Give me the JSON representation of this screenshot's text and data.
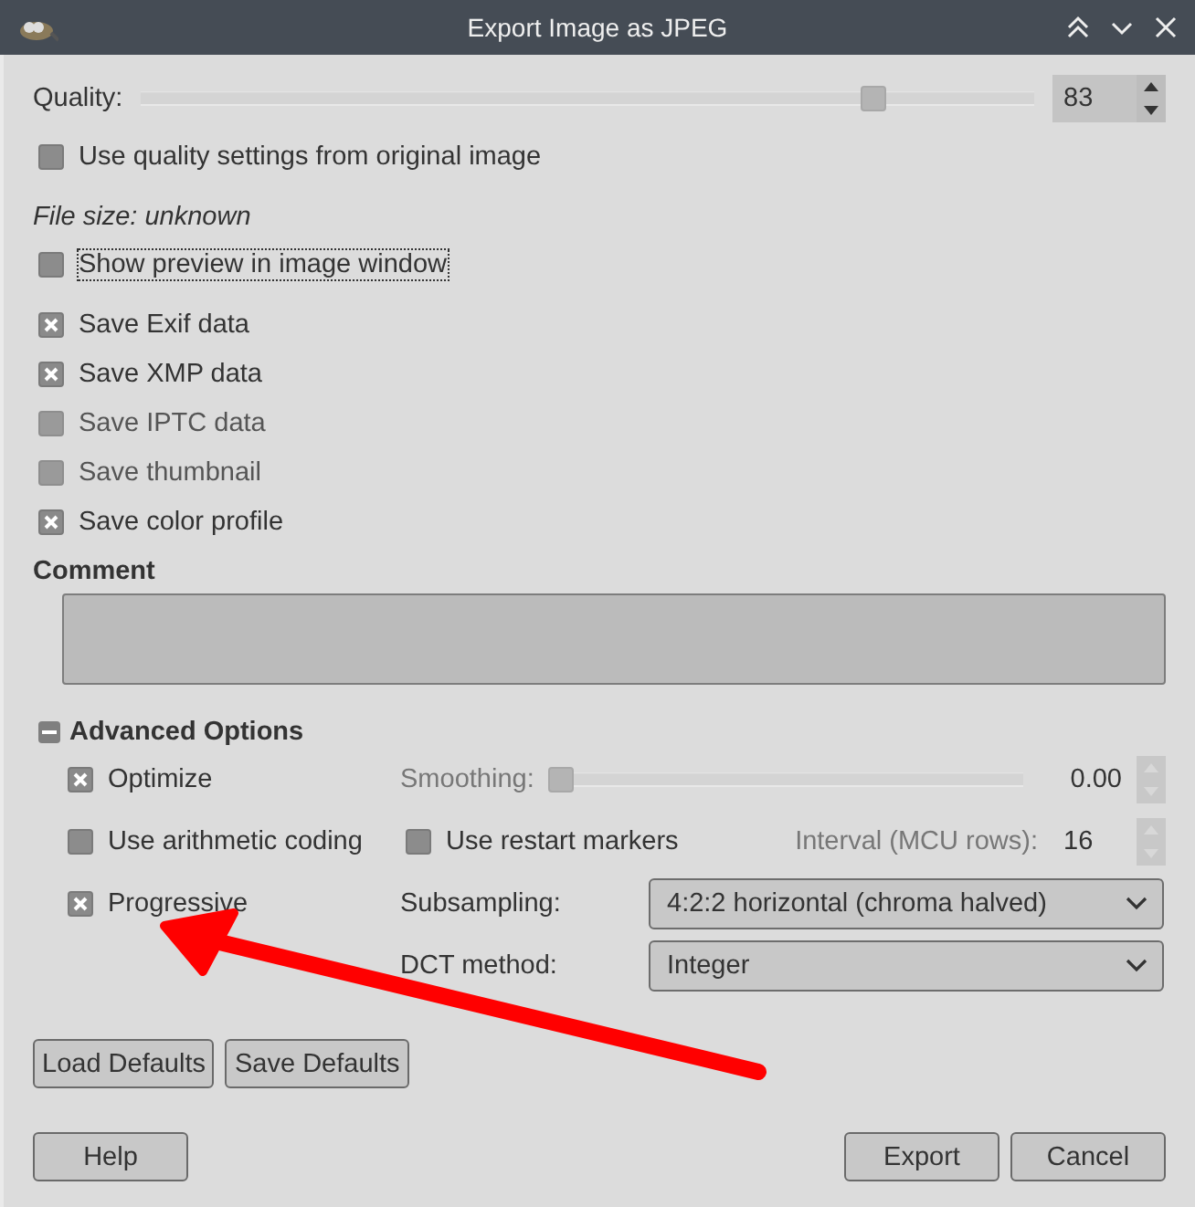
{
  "window": {
    "title": "Export Image as JPEG"
  },
  "quality": {
    "label": "Quality:",
    "level": 0.83,
    "value": "83"
  },
  "options": [
    {
      "label": "Use quality settings from original image",
      "checked": false,
      "disabled": false,
      "focused": false
    }
  ],
  "file_size": "File size: unknown",
  "preview": {
    "label": "Show preview in image window",
    "checked": false,
    "disabled": false,
    "focused": true
  },
  "metadata": [
    {
      "label": "Save Exif data",
      "checked": true,
      "disabled": false
    },
    {
      "label": "Save XMP data",
      "checked": true,
      "disabled": false
    },
    {
      "label": "Save IPTC data",
      "checked": false,
      "disabled": true
    },
    {
      "label": "Save thumbnail",
      "checked": false,
      "disabled": true
    },
    {
      "label": "Save color profile",
      "checked": true,
      "disabled": false
    }
  ],
  "comment": {
    "label": "Comment"
  },
  "advanced": {
    "label": "Advanced Options",
    "expanded": true,
    "optimize": {
      "label": "Optimize",
      "checked": true
    },
    "smoothing": {
      "label": "Smoothing:",
      "level": 0,
      "value": "0.00",
      "disabled": true
    },
    "arithmetic": {
      "label": "Use arithmetic coding",
      "checked": false
    },
    "restart": {
      "label": "Use restart markers",
      "checked": false
    },
    "interval": {
      "label": "Interval (MCU rows):",
      "value": "16",
      "disabled": true
    },
    "progressive": {
      "label": "Progressive",
      "checked": true
    },
    "subsampling": {
      "label": "Subsampling:",
      "value": "4:2:2 horizontal (chroma halved)"
    },
    "dct": {
      "label": "DCT method:",
      "value": "Integer"
    }
  },
  "defaults_buttons": [
    "Load Defaults",
    "Save Defaults"
  ],
  "help_button": "Help",
  "action_buttons": [
    "Export",
    "Cancel"
  ],
  "annotation": {
    "kind": "arrow",
    "color": "#ff0000"
  }
}
